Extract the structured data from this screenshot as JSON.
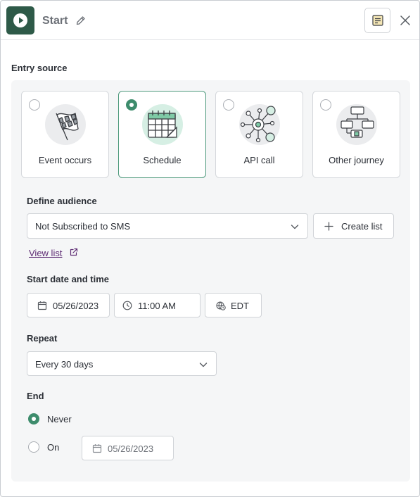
{
  "header": {
    "title": "Start",
    "start_icon": "play-icon",
    "edit_icon": "pencil-icon",
    "notes_icon": "notes-icon",
    "close_icon": "close-icon"
  },
  "entry_source": {
    "label": "Entry source",
    "options": [
      {
        "label": "Event occurs",
        "icon": "checkered-flag-icon",
        "selected": false
      },
      {
        "label": "Schedule",
        "icon": "calendar-icon",
        "selected": true
      },
      {
        "label": "API call",
        "icon": "network-icon",
        "selected": false
      },
      {
        "label": "Other journey",
        "icon": "flowchart-icon",
        "selected": false
      }
    ]
  },
  "audience": {
    "label": "Define audience",
    "selected": "Not Subscribed to SMS",
    "create_list_label": "Create list",
    "view_list_label": "View list"
  },
  "start": {
    "label": "Start date and time",
    "date": "05/26/2023",
    "time": "11:00 AM",
    "timezone": "EDT"
  },
  "repeat": {
    "label": "Repeat",
    "selected": "Every 30 days"
  },
  "end": {
    "label": "End",
    "never_label": "Never",
    "on_label": "On",
    "on_date": "05/26/2023",
    "selected": "Never"
  },
  "colors": {
    "accent": "#3d8c6c",
    "header_icon_bg": "#2e5a48",
    "link": "#5d2b73",
    "panel_bg": "#f5f6f7"
  }
}
